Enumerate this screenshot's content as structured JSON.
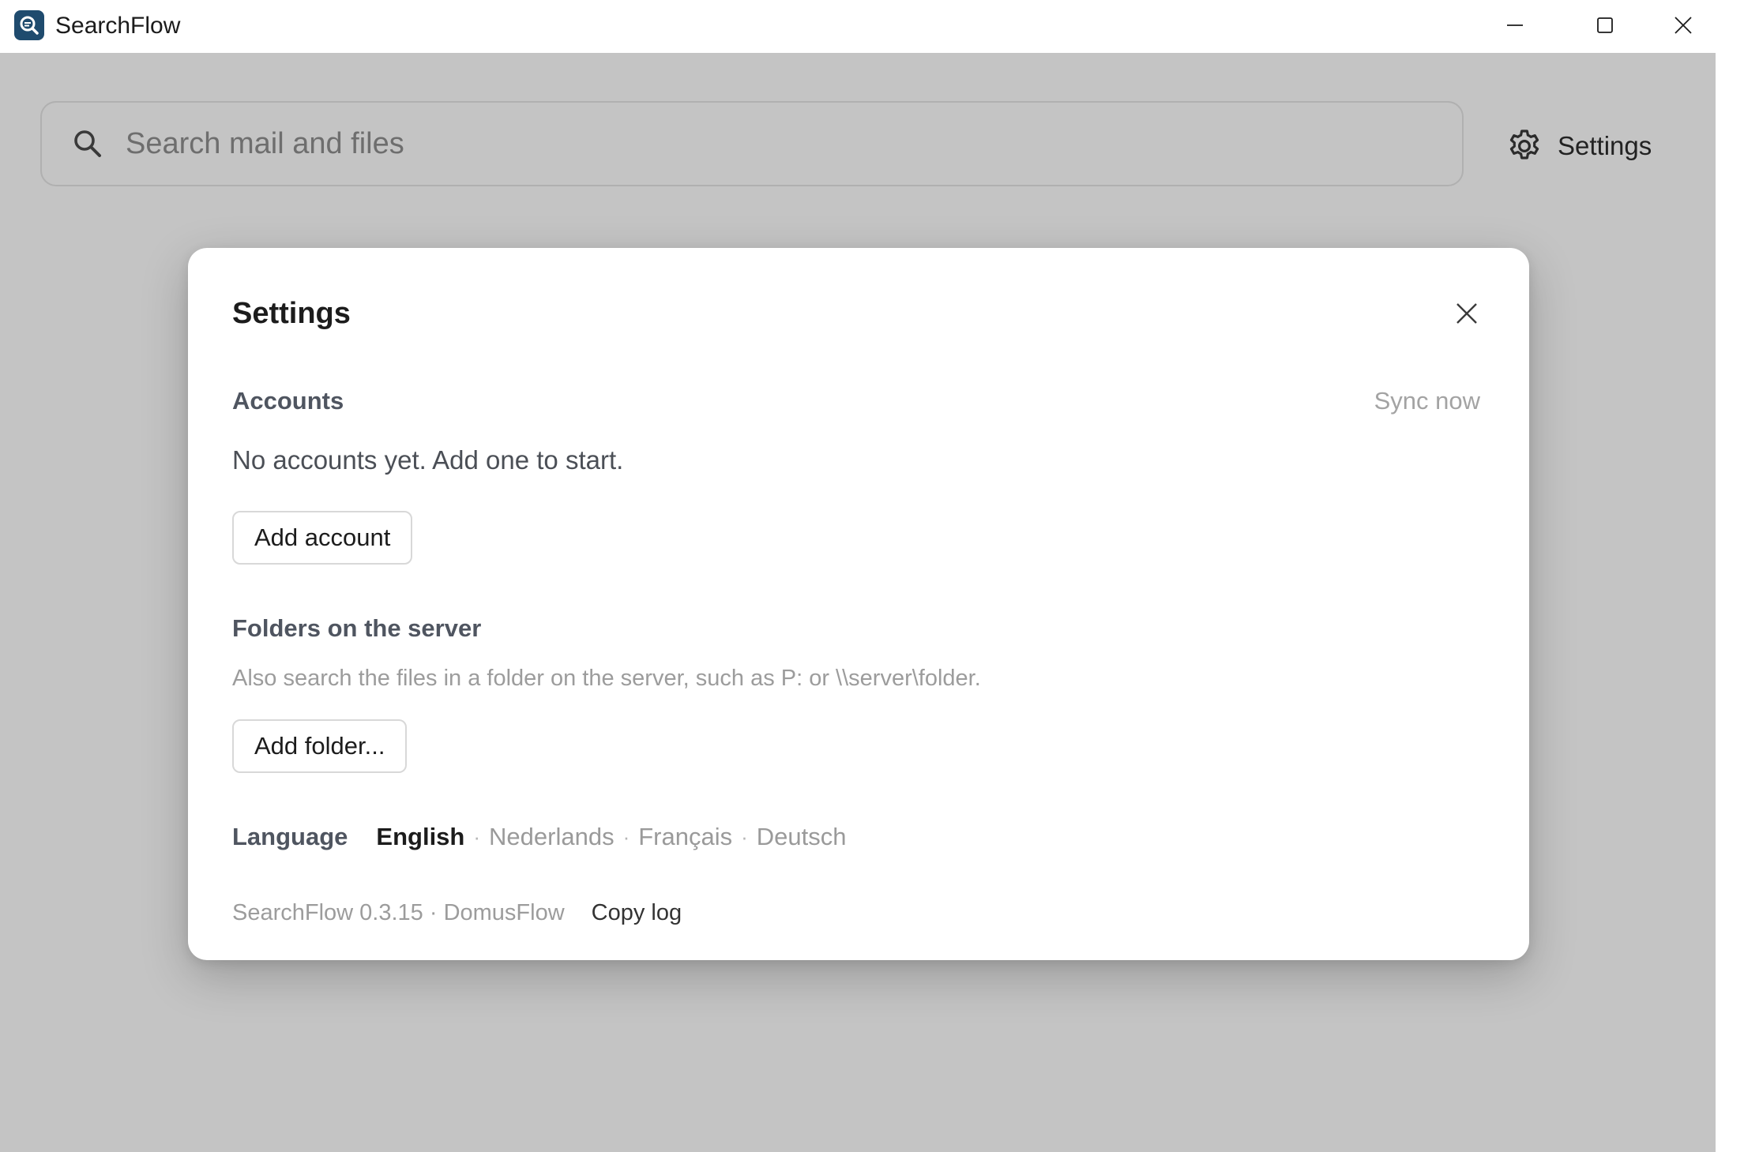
{
  "app": {
    "title": "SearchFlow",
    "accent": "#1f4b6e"
  },
  "window_controls": {
    "minimize": "minimize-icon",
    "maximize": "maximize-icon",
    "close": "close-icon"
  },
  "search": {
    "placeholder": "Search mail and files",
    "value": ""
  },
  "header": {
    "settings_label": "Settings"
  },
  "dialog": {
    "title": "Settings",
    "accounts": {
      "heading": "Accounts",
      "sync_label": "Sync now",
      "empty_text": "No accounts yet. Add one to start.",
      "add_button": "Add account"
    },
    "folders": {
      "heading": "Folders on the server",
      "hint": "Also search the files in a folder on the server, such as P: or \\\\server\\folder.",
      "add_button": "Add folder..."
    },
    "language": {
      "label": "Language",
      "options": [
        "English",
        "Nederlands",
        "Français",
        "Deutsch"
      ],
      "selected": "English",
      "separator": "·"
    },
    "footer": {
      "version": "SearchFlow 0.3.15 · DomusFlow",
      "copy_log": "Copy log"
    }
  }
}
